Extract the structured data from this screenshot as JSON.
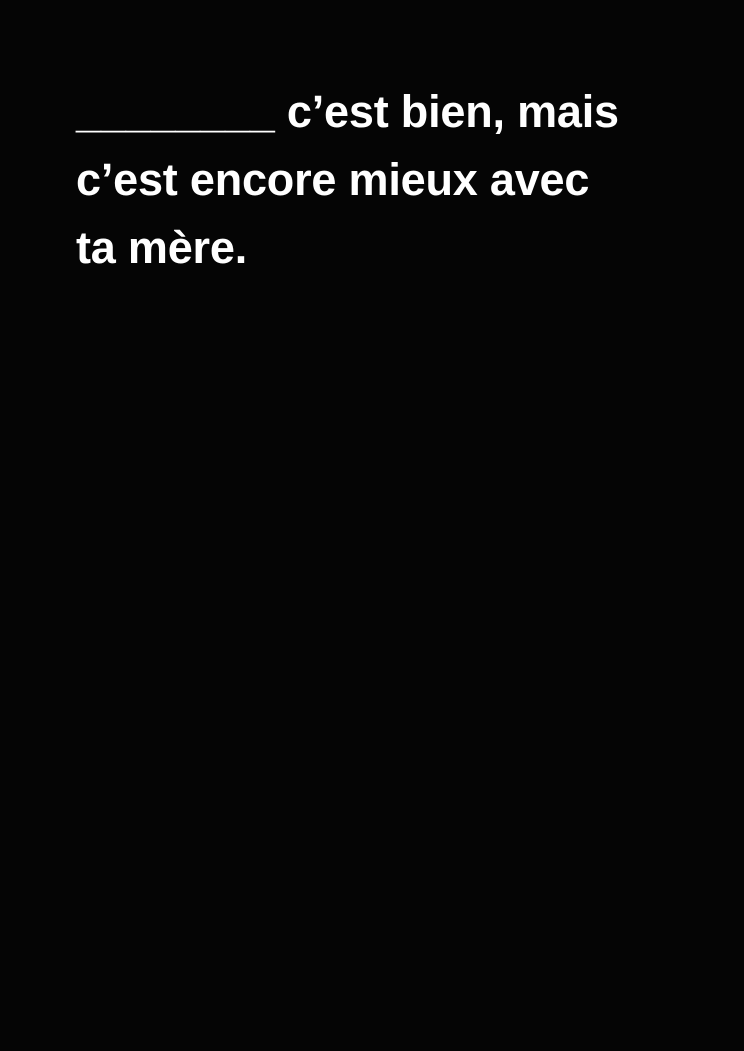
{
  "card": {
    "lines": [
      "________ c’est bien, mais",
      "c’est encore mieux avec",
      "ta mère."
    ]
  }
}
